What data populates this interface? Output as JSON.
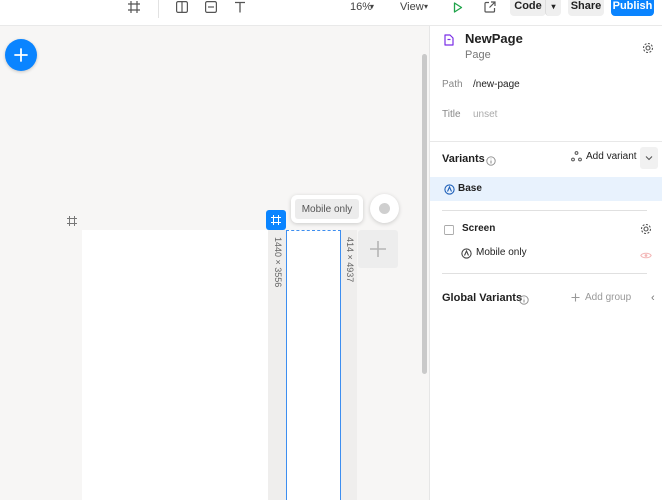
{
  "toolbar": {
    "zoom": "16%",
    "view_label": "View",
    "code_label": "Code",
    "share_label": "Share",
    "publish_label": "Publish"
  },
  "canvas": {
    "desktop_size": "1440 × 3556",
    "mobile_size": "414 × 4937",
    "tooltip": "Mobile only"
  },
  "panel": {
    "page_name": "NewPage",
    "page_kind": "Page",
    "path_label": "Path",
    "path_value": "/new-page",
    "title_label": "Title",
    "title_value": "unset",
    "variants": {
      "title": "Variants",
      "add_label": "Add variant",
      "base_label": "Base",
      "group_label": "Screen",
      "items": [
        {
          "label": "Mobile only"
        }
      ]
    },
    "global_variants": {
      "title": "Global Variants",
      "add_label": "Add group"
    }
  },
  "colors": {
    "accent": "#0a84ff",
    "selected_row": "#e8f2fd",
    "page_icon": "#7a2ee6",
    "play_icon": "#1fa34a"
  }
}
